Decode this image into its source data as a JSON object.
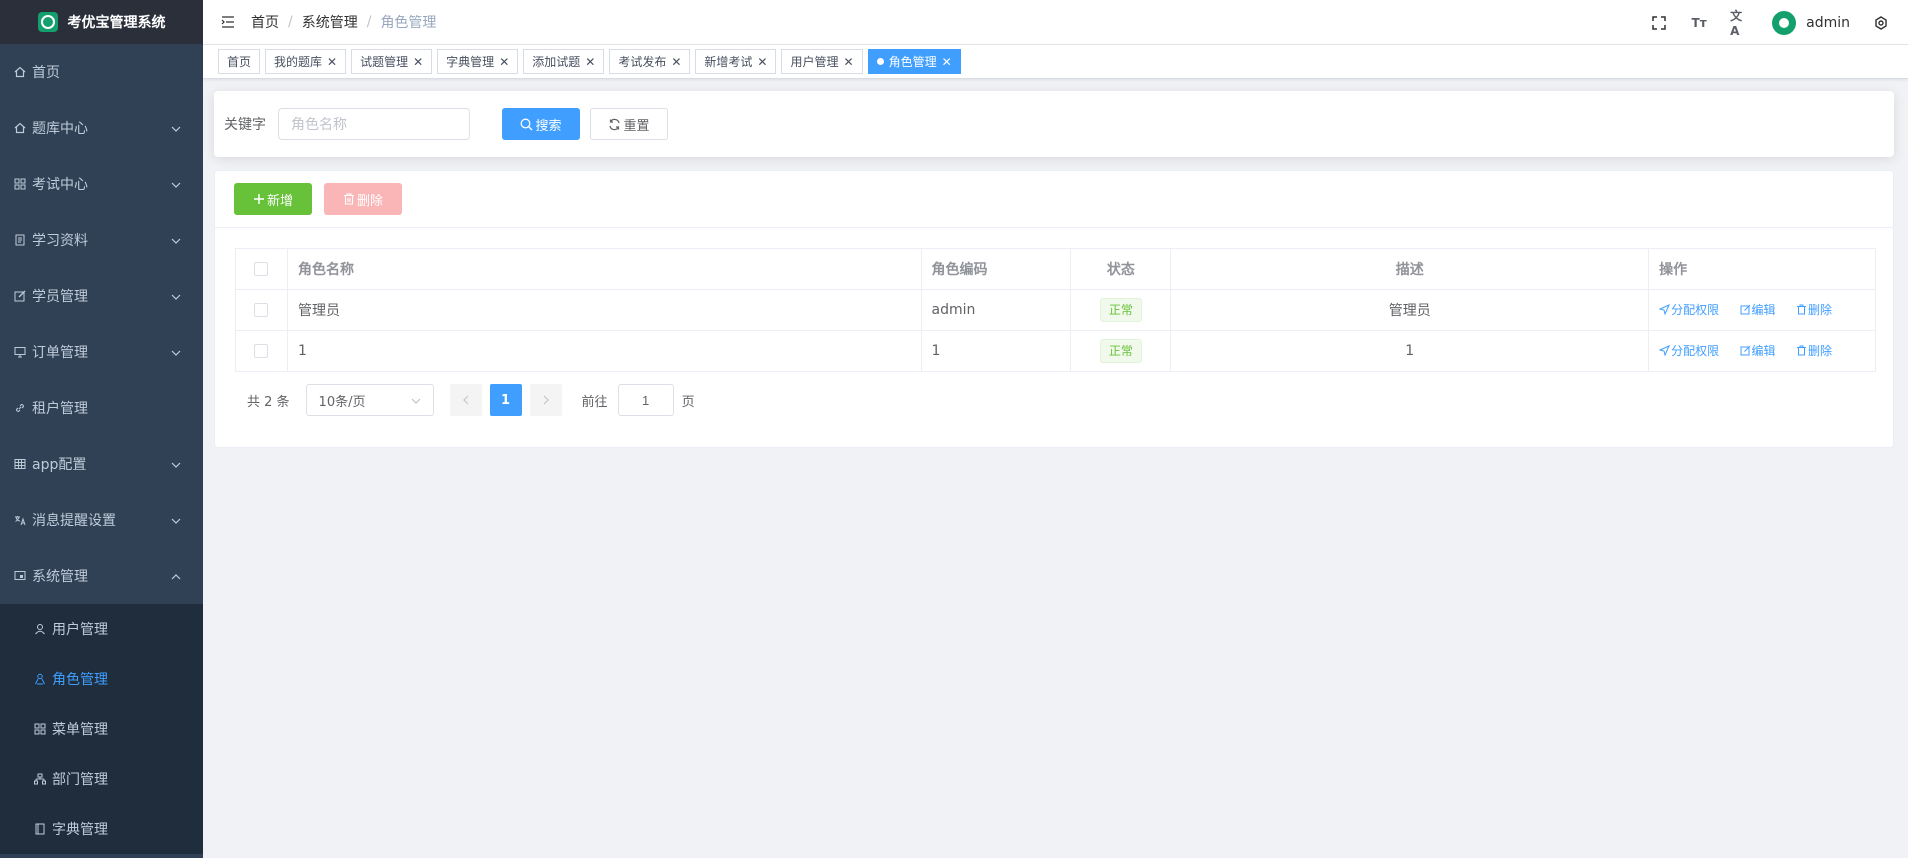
{
  "app": {
    "title": "考优宝管理系统"
  },
  "sidebar": {
    "items": [
      {
        "label": "首页",
        "icon": "home-icon",
        "has_children": false
      },
      {
        "label": "题库中心",
        "icon": "home-icon",
        "has_children": true
      },
      {
        "label": "考试中心",
        "icon": "grid-icon",
        "has_children": true
      },
      {
        "label": "学习资料",
        "icon": "document-icon",
        "has_children": true
      },
      {
        "label": "学员管理",
        "icon": "edit-icon",
        "has_children": true
      },
      {
        "label": "订单管理",
        "icon": "monitor-icon",
        "has_children": true
      },
      {
        "label": "租户管理",
        "icon": "link-icon",
        "has_children": false
      },
      {
        "label": "app配置",
        "icon": "table-icon",
        "has_children": true
      },
      {
        "label": "消息提醒设置",
        "icon": "language-icon",
        "has_children": true
      },
      {
        "label": "系统管理",
        "icon": "system-icon",
        "has_children": true,
        "expanded": true
      }
    ],
    "sub_items": [
      {
        "label": "用户管理",
        "icon": "user-icon"
      },
      {
        "label": "角色管理",
        "icon": "peoples-icon",
        "active": true
      },
      {
        "label": "菜单管理",
        "icon": "tree-icon"
      },
      {
        "label": "部门管理",
        "icon": "tree-table-icon"
      },
      {
        "label": "字典管理",
        "icon": "dict-icon"
      }
    ]
  },
  "header": {
    "breadcrumb": [
      "首页",
      "系统管理",
      "角色管理"
    ],
    "username": "admin",
    "font_size_icon_text": "Tт",
    "lang_icon_text": "文A"
  },
  "tags": [
    {
      "label": "首页",
      "closable": false
    },
    {
      "label": "我的题库",
      "closable": true
    },
    {
      "label": "试题管理",
      "closable": true
    },
    {
      "label": "字典管理",
      "closable": true
    },
    {
      "label": "添加试题",
      "closable": true
    },
    {
      "label": "考试发布",
      "closable": true
    },
    {
      "label": "新增考试",
      "closable": true
    },
    {
      "label": "用户管理",
      "closable": true
    },
    {
      "label": "角色管理",
      "closable": true,
      "active": true
    }
  ],
  "search": {
    "label": "关键字",
    "placeholder": "角色名称",
    "search_button": "搜索",
    "reset_button": "重置"
  },
  "toolbar": {
    "add_button": "新增",
    "delete_button": "删除"
  },
  "table": {
    "columns": [
      "角色名称",
      "角色编码",
      "状态",
      "描述",
      "操作"
    ],
    "rows": [
      {
        "name": "管理员",
        "code": "admin",
        "status": "正常",
        "desc": "管理员"
      },
      {
        "name": "1",
        "code": "1",
        "status": "正常",
        "desc": "1"
      }
    ],
    "ops": {
      "assign": "分配权限",
      "edit": "编辑",
      "delete": "删除"
    }
  },
  "pagination": {
    "total_text": "共 2 条",
    "page_size": "10条/页",
    "current_page": "1",
    "goto_label": "前往",
    "goto_value": "1",
    "page_suffix": "页"
  },
  "colors": {
    "primary": "#409eff",
    "success": "#67c23a",
    "sidebar_bg": "#304156"
  }
}
